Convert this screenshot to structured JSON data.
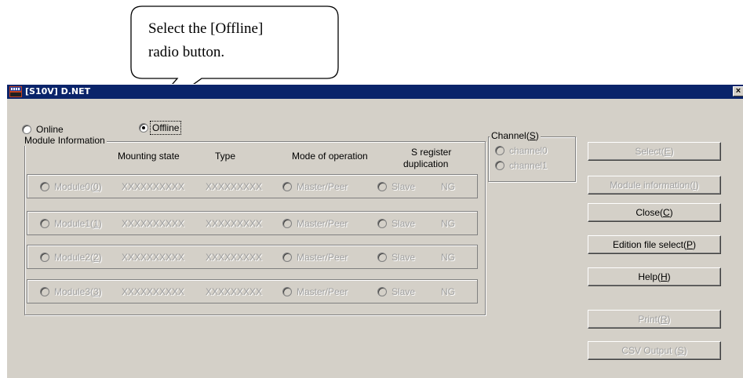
{
  "callout": {
    "line1": "Select the [Offline]",
    "line2": "radio button."
  },
  "window": {
    "title": "[S10V] D.NET",
    "close_glyph": "×"
  },
  "mode": {
    "online_label": "Online",
    "offline_label": "Offline",
    "selected": "Offline"
  },
  "module_info": {
    "legend": "Module Information",
    "headers": {
      "mounting_state": "Mounting state",
      "type": "Type",
      "mode": "Mode of operation",
      "sreg1": "S register",
      "sreg2": "duplication"
    },
    "rows": [
      {
        "name": "Module0",
        "key": "0",
        "mounting": "XXXXXXXXXX",
        "type": "XXXXXXXXX",
        "master": "Master/Peer",
        "slave": "Slave",
        "dup": "NG"
      },
      {
        "name": "Module1",
        "key": "1",
        "mounting": "XXXXXXXXXX",
        "type": "XXXXXXXXX",
        "master": "Master/Peer",
        "slave": "Slave",
        "dup": "NG"
      },
      {
        "name": "Module2",
        "key": "2",
        "mounting": "XXXXXXXXXX",
        "type": "XXXXXXXXX",
        "master": "Master/Peer",
        "slave": "Slave",
        "dup": "NG"
      },
      {
        "name": "Module3",
        "key": "3",
        "mounting": "XXXXXXXXXX",
        "type": "XXXXXXXXX",
        "master": "Master/Peer",
        "slave": "Slave",
        "dup": "NG"
      }
    ]
  },
  "channel": {
    "legend": "Channel",
    "legend_key": "S",
    "items": [
      "channel0",
      "channel1"
    ]
  },
  "buttons": [
    {
      "label": "Select",
      "key": "E",
      "enabled": false
    },
    {
      "label": "Module information",
      "key": "I",
      "enabled": false
    },
    {
      "label": "Close",
      "key": "C",
      "enabled": true
    },
    {
      "label": "Edition file select",
      "key": "P",
      "enabled": true
    },
    {
      "label": "Help",
      "key": "H",
      "enabled": true
    },
    {
      "label": "Print",
      "key": "R",
      "enabled": false
    },
    {
      "label": "CSV Output ",
      "key": "S",
      "enabled": false
    }
  ]
}
